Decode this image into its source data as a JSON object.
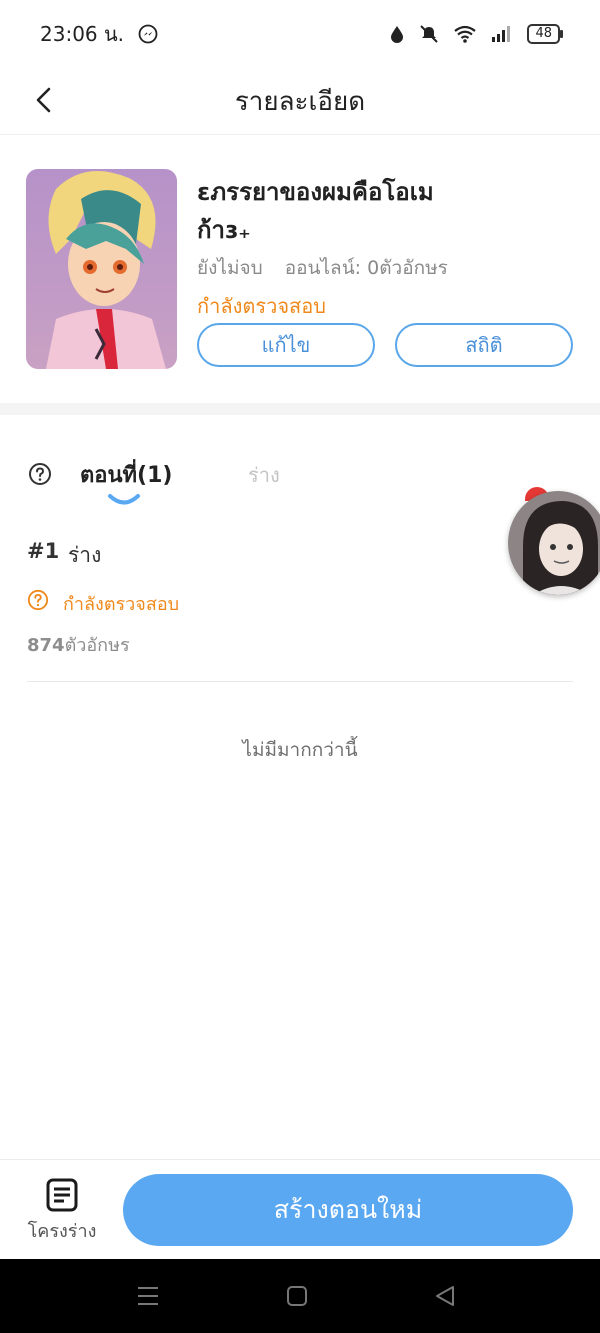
{
  "status_bar": {
    "time": "23:06 น.",
    "battery": "48",
    "icons": [
      "messenger-icon",
      "water-drop-icon",
      "bell-muted-icon",
      "wifi-icon",
      "signal-icon",
      "battery-icon"
    ]
  },
  "header": {
    "title": "รายละเอียด",
    "back_icon": "chevron-left-icon"
  },
  "book": {
    "title_line1": "ɛภรรยาของผมคือโอเม",
    "title_line2": "ก้าɜ₊",
    "progress": "ยังไม่จบ",
    "online": "ออนไลน์: 0ตัวอักษร",
    "status": "กำลังตรวจสอบ",
    "edit_label": "แก้ไข",
    "stats_label": "สถิติ"
  },
  "tabs": {
    "help_icon": "question-circle-icon",
    "chapters_label": "ตอนที่(1)",
    "draft_label": "ร่าง"
  },
  "chapters": [
    {
      "num": "#1",
      "title": "ร่าง",
      "status": "กำลังตรวจสอบ",
      "count_number": "874",
      "count_unit": "ตัวอักษร"
    }
  ],
  "footer_note": "ไม่มีมากกว่านี้",
  "bottom_bar": {
    "draft_label": "โครงร่าง",
    "new_chapter_label": "สร้างตอนใหม่"
  },
  "colors": {
    "accent_blue": "#5aa8f2",
    "status_orange": "#f0891c",
    "outline_blue": "#5aa6ea"
  }
}
